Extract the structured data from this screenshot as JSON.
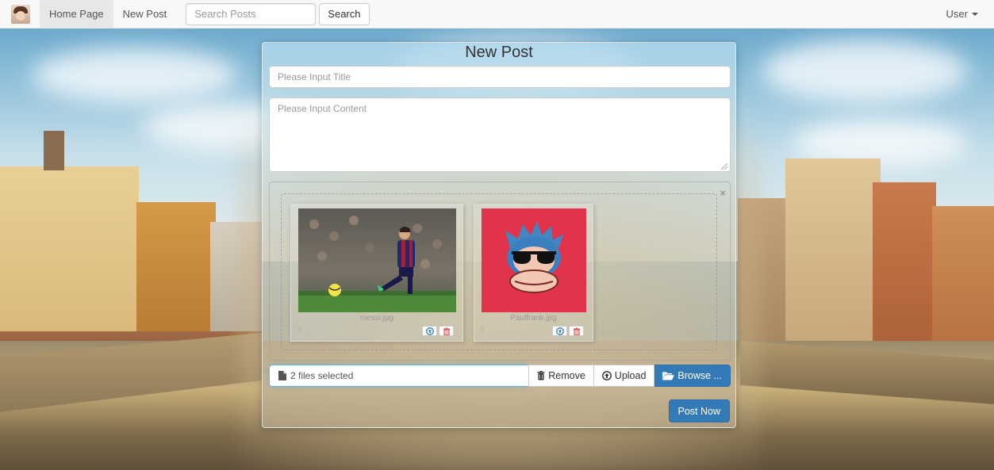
{
  "navbar": {
    "home_label": "Home Page",
    "new_post_label": "New Post",
    "search_placeholder": "Search Posts",
    "search_button": "Search",
    "user_label": "User"
  },
  "form": {
    "heading": "New Post",
    "title_placeholder": "Please Input Title",
    "content_placeholder": "Please Input Content",
    "files": [
      {
        "name": "messi.jpg",
        "thumbnail": "soccer player kicking ball"
      },
      {
        "name": "Paulfrank.jpg",
        "thumbnail": "monkey with sunglasses on red background"
      }
    ],
    "file_caption": "2 files selected",
    "remove_label": "Remove",
    "upload_label": "Upload",
    "browse_label": "Browse ...",
    "submit_label": "Post Now"
  },
  "colors": {
    "primary": "#337ab7",
    "danger": "#d9534f",
    "info": "#337ab7"
  }
}
